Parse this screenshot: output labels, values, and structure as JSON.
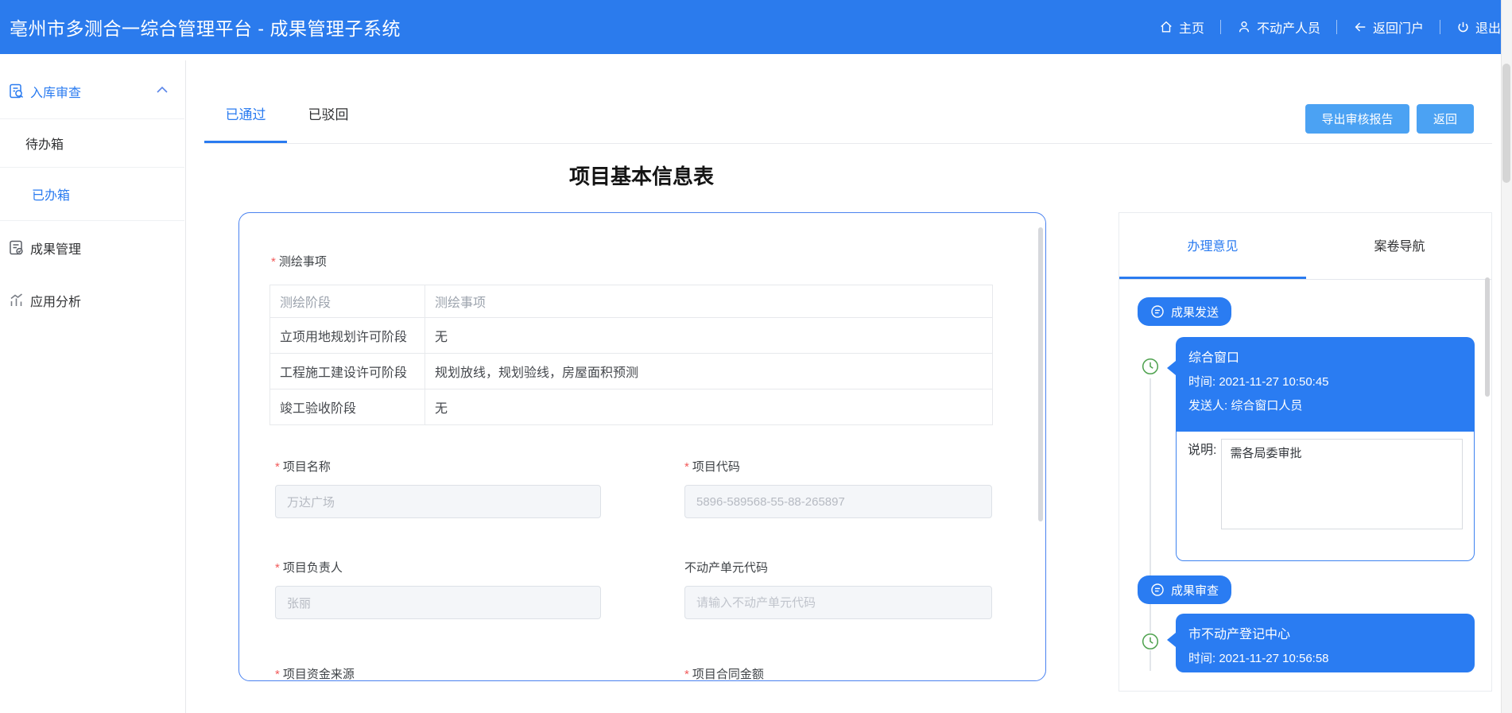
{
  "header": {
    "title": "亳州市多测合一综合管理平台 - 成果管理子系统",
    "nav": [
      {
        "label": "主页",
        "icon": "home-icon"
      },
      {
        "label": "不动产人员",
        "icon": "user-icon"
      },
      {
        "label": "返回门户",
        "icon": "back-arrow-icon"
      },
      {
        "label": "退出",
        "icon": "power-icon"
      }
    ]
  },
  "sidebar": {
    "items": [
      {
        "label": "入库审查",
        "icon": "audit-search-icon",
        "expanded": true,
        "active": true,
        "children": [
          {
            "label": "待办箱",
            "active": false
          },
          {
            "label": "已办箱",
            "active": true
          }
        ]
      },
      {
        "label": "成果管理",
        "icon": "document-check-icon",
        "active": false
      },
      {
        "label": "应用分析",
        "icon": "bar-chart-icon",
        "active": false
      }
    ]
  },
  "toolbar": {
    "tabs": [
      {
        "label": "已通过",
        "active": true
      },
      {
        "label": "已驳回",
        "active": false
      }
    ],
    "export_label": "导出审核报告",
    "back_label": "返回"
  },
  "form": {
    "title": "项目基本信息表",
    "survey_section_label": "测绘事项",
    "table": {
      "headers": [
        "测绘阶段",
        "测绘事项"
      ],
      "rows": [
        [
          "立项用地规划许可阶段",
          "无"
        ],
        [
          "工程施工建设许可阶段",
          "规划放线，规划验线，房屋面积预测"
        ],
        [
          "竣工验收阶段",
          "无"
        ]
      ]
    },
    "fields": {
      "project_name": {
        "label": "项目名称",
        "required": true,
        "value": "万达广场"
      },
      "project_code": {
        "label": "项目代码",
        "required": true,
        "value": "5896-589568-55-88-265897"
      },
      "project_leader": {
        "label": "项目负责人",
        "required": true,
        "value": "张丽"
      },
      "estate_unit_code": {
        "label": "不动产单元代码",
        "required": false,
        "placeholder": "请输入不动产单元代码"
      },
      "funding_source": {
        "label": "项目资金来源",
        "required": true
      },
      "contract_amount": {
        "label": "项目合同金额",
        "required": true
      }
    }
  },
  "panel": {
    "tabs": [
      {
        "label": "办理意见",
        "active": true
      },
      {
        "label": "案卷导航",
        "active": false
      }
    ],
    "timeline": [
      {
        "badge": "成果发送",
        "title": "综合窗口",
        "time_label": "时间:",
        "time": "2021-11-27 10:50:45",
        "sender_label": "发送人:",
        "sender": "综合窗口人员",
        "note_label": "说明:",
        "note": "需各局委审批"
      },
      {
        "badge": "成果审查",
        "title": "市不动产登记中心",
        "time_label": "时间:",
        "time": "2021-11-27 10:56:58"
      }
    ]
  },
  "colors": {
    "header_blue": "#2b7bed",
    "accent_blue": "#2a7bf0",
    "button_blue": "#4ba2f3",
    "panel_border_blue": "#4a82f0",
    "timeline_green": "#4da14d",
    "required_red": "#f25a5a"
  }
}
